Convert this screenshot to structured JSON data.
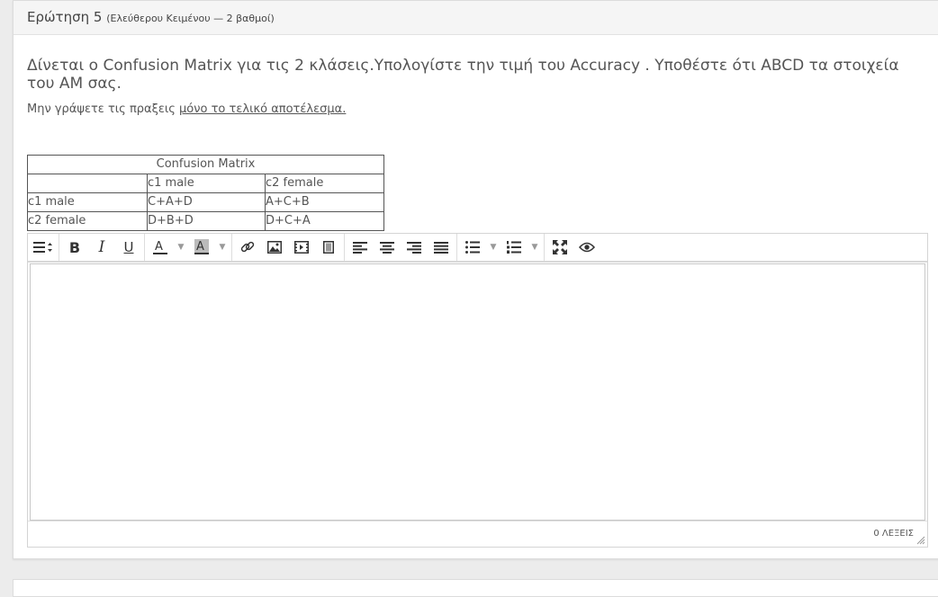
{
  "question": {
    "title": "Ερώτηση 5",
    "subtitle": "(Ελεύθερου Κειμένου — 2 βαθμοί)",
    "text": "Δίνεται ο Confusion Matrix για τις 2 κλάσεις.Υπολογίστε την τιμή του Accuracy . Υποθέστε ότι ABCD τα στοιχεία του ΑΜ σας.",
    "hint_plain": "Μην γράψετε τις πραξεις ",
    "hint_underlined": "μόνο το τελικό αποτέλεσμα."
  },
  "matrix": {
    "title": "Confusion Matrix",
    "col_headers": [
      "",
      "c1 male",
      "c2 female"
    ],
    "rows": [
      [
        "c1 male",
        "C+A+D",
        "A+C+B"
      ],
      [
        "c2 female",
        "D+B+D",
        "D+C+A"
      ]
    ]
  },
  "editor": {
    "toolbar": [
      {
        "group": "format",
        "icons": [
          "paragraph-format-icon"
        ]
      },
      {
        "group": "text-style",
        "icons": [
          "bold-icon",
          "italic-icon",
          "underline-icon"
        ]
      },
      {
        "group": "colors",
        "icons": [
          "text-color-icon",
          "background-color-icon"
        ]
      },
      {
        "group": "insert",
        "icons": [
          "link-icon",
          "image-icon",
          "video-icon",
          "file-icon"
        ]
      },
      {
        "group": "align",
        "icons": [
          "align-left-icon",
          "align-center-icon",
          "align-right-icon",
          "align-justify-icon"
        ]
      },
      {
        "group": "lists",
        "icons": [
          "bulleted-list-icon",
          "numbered-list-icon"
        ]
      },
      {
        "group": "view",
        "icons": [
          "fullscreen-icon",
          "preview-icon"
        ]
      }
    ],
    "content": "",
    "word_count": "0 ΛΕΞΕΙΣ"
  }
}
